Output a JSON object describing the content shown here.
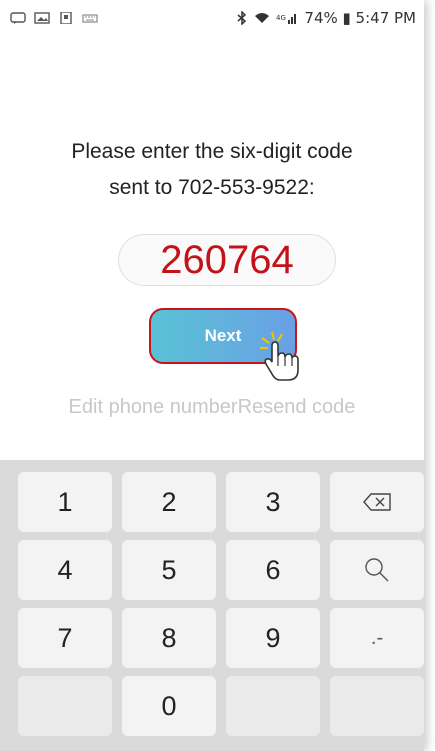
{
  "status_bar": {
    "right_text": "74% ▮ 5:47 PM"
  },
  "prompt": {
    "line1": "Please enter the six-digit code",
    "line2": "sent to 702-553-9522:"
  },
  "code_field": {
    "value": "260764"
  },
  "next_button": {
    "label": "Next"
  },
  "links": {
    "edit_phone": "Edit phone number",
    "resend_code": "Resend code"
  },
  "keypad": {
    "keys": [
      "1",
      "2",
      "3",
      "4",
      "5",
      "6",
      "7",
      "8",
      "9",
      "0"
    ],
    "special": {
      "backspace": "backspace-icon",
      "search": "search-icon",
      "punct": ".-"
    }
  },
  "colors": {
    "code_red": "#c31218",
    "button_border": "#c3171c",
    "button_gradient_start": "#59c2d6",
    "button_gradient_end": "#6aa0e5",
    "keypad_bg": "#dadada"
  }
}
